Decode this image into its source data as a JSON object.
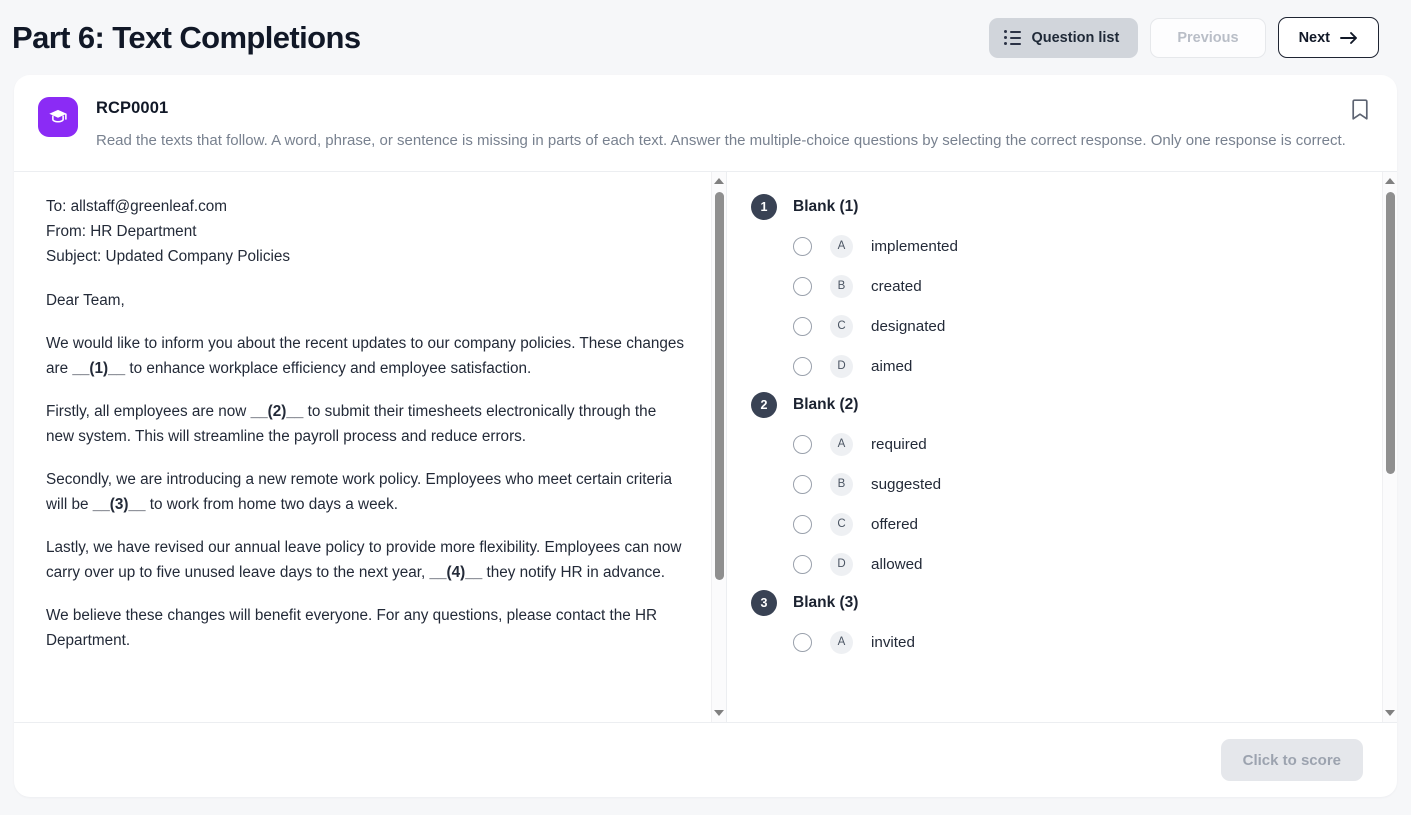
{
  "header": {
    "title": "Part 6: Text Completions",
    "question_list_label": "Question list",
    "previous_label": "Previous",
    "next_label": "Next"
  },
  "card": {
    "code": "RCP0001",
    "directions": "Read the texts that follow. A word, phrase, or sentence is missing in parts of each text. Answer the multiple-choice questions by selecting the correct response. Only one response is correct."
  },
  "passage": {
    "paragraphs": [
      "To: allstaff@greenleaf.com\nFrom: HR Department\nSubject: Updated Company Policies",
      "Dear Team,",
      "We would like to inform you about the recent updates to our company policies. These changes are __(1)__ to enhance workplace efficiency and employee satisfaction.",
      "Firstly, all employees are now __(2)__ to submit their timesheets electronically through the new system. This will streamline the payroll process and reduce errors.",
      "Secondly, we are introducing a new remote work policy. Employees who meet certain criteria will be __(3)__ to work from home two days a week.",
      "Lastly, we have revised our annual leave policy to provide more flexibility. Employees can now carry over up to five unused leave days to the next year, __(4)__ they notify HR in advance.",
      "We believe these changes will benefit everyone. For any questions, please contact the HR Department."
    ],
    "lines": {
      "to": "To: allstaff@greenleaf.com",
      "from": "From: HR Department",
      "subject": "Subject: Updated Company Policies",
      "greeting": "Dear Team,",
      "p1_a": "We would like to inform you about the recent updates to our company policies. These changes are ",
      "p1_blank": "__(1)__",
      "p1_b": " to enhance workplace efficiency and employee satisfaction.",
      "p2_a": "Firstly, all employees are now ",
      "p2_blank": "__(2)__",
      "p2_b": " to submit their timesheets electronically through the new system. This will streamline the payroll process and reduce errors.",
      "p3_a": "Secondly, we are introducing a new remote work policy. Employees who meet certain criteria will be ",
      "p3_blank": "__(3)__",
      "p3_b": " to work from home two days a week.",
      "p4_a": "Lastly, we have revised our annual leave policy to provide more flexibility. Employees can now carry over up to five unused leave days to the next year, ",
      "p4_blank": "__(4)__",
      "p4_b": " they notify HR in advance.",
      "p5": "We believe these changes will benefit everyone. For any questions, please contact the HR Department."
    }
  },
  "questions": [
    {
      "number": "1",
      "title": "Blank (1)",
      "options": [
        {
          "letter": "A",
          "text": "implemented"
        },
        {
          "letter": "B",
          "text": "created"
        },
        {
          "letter": "C",
          "text": "designated"
        },
        {
          "letter": "D",
          "text": "aimed"
        }
      ]
    },
    {
      "number": "2",
      "title": "Blank (2)",
      "options": [
        {
          "letter": "A",
          "text": "required"
        },
        {
          "letter": "B",
          "text": "suggested"
        },
        {
          "letter": "C",
          "text": "offered"
        },
        {
          "letter": "D",
          "text": "allowed"
        }
      ]
    },
    {
      "number": "3",
      "title": "Blank (3)",
      "options": [
        {
          "letter": "A",
          "text": "invited"
        }
      ]
    }
  ],
  "footer": {
    "score_label": "Click to score"
  },
  "colors": {
    "accent_purple": "#8b2bf5",
    "page_bg": "#f6f7f9",
    "question_number_bg": "#394254"
  }
}
